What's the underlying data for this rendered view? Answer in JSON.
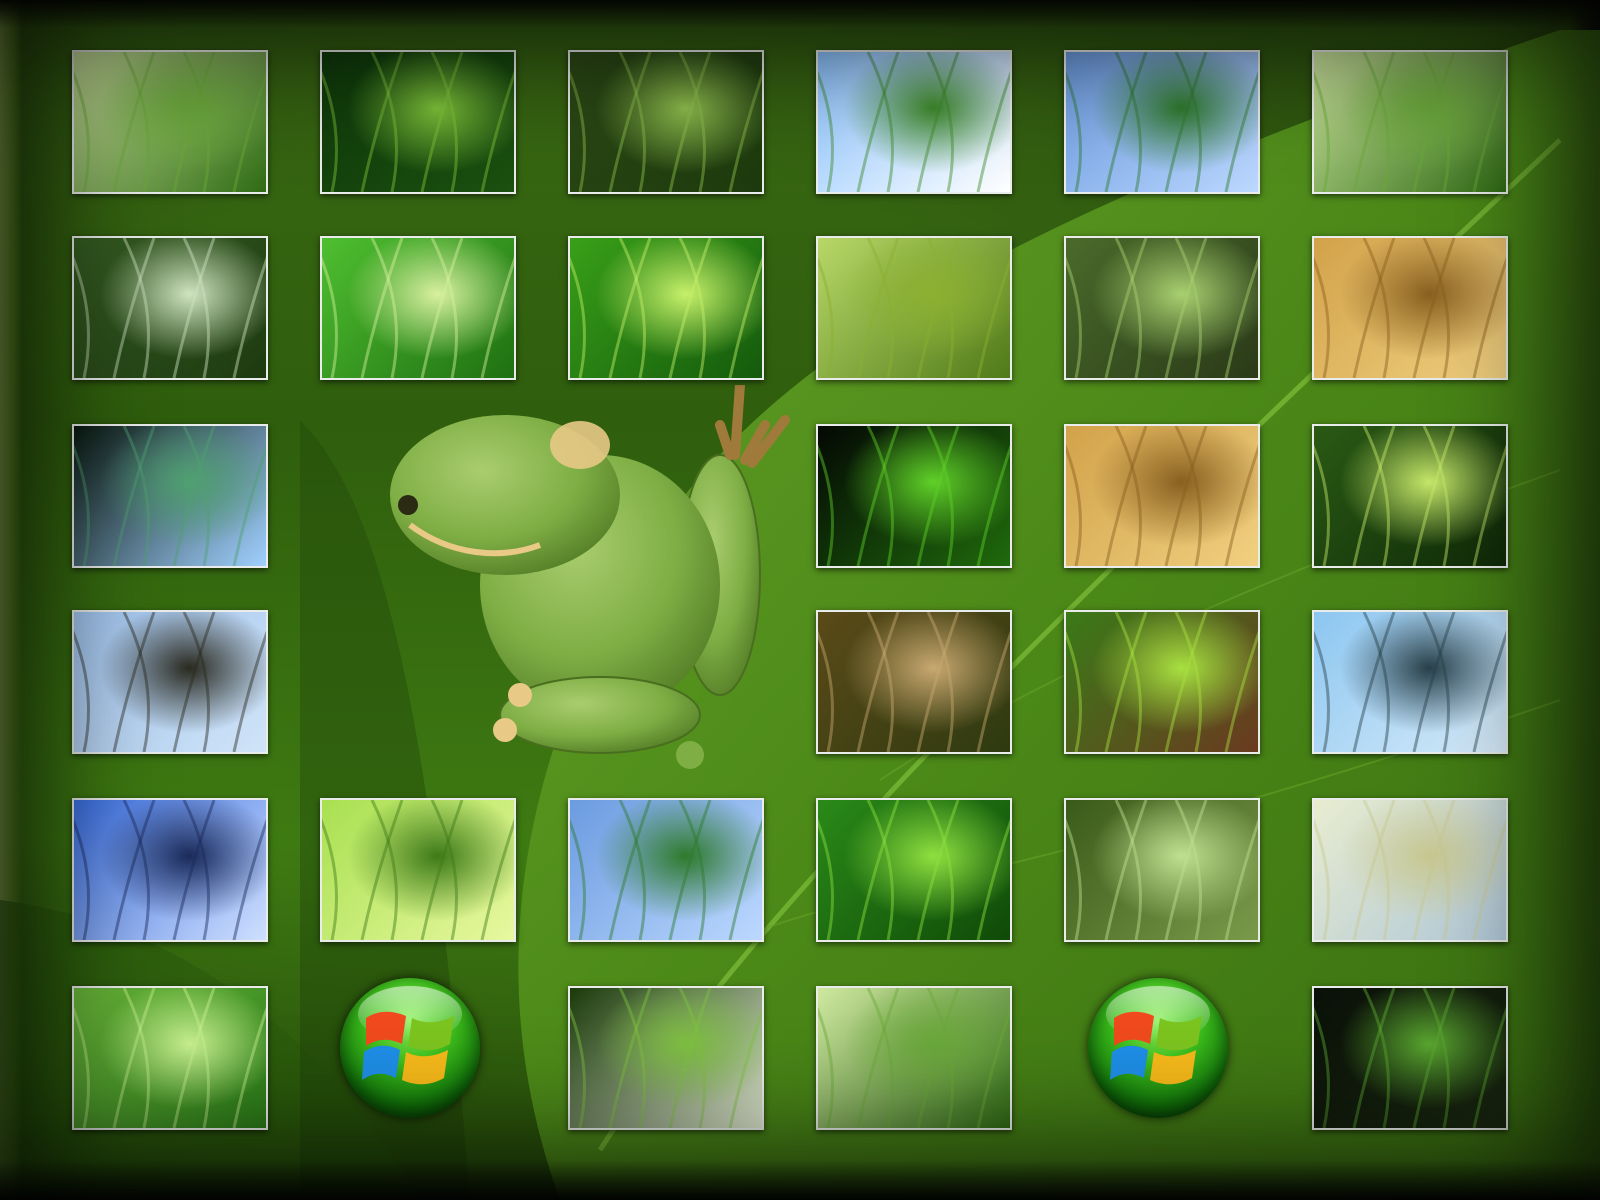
{
  "wallpaper": {
    "theme": "nature-collage",
    "colors": {
      "background": "#3b6a14",
      "thumb_border": "#e9ecea",
      "orb_green": "#3fbf1d"
    }
  },
  "photos": [
    {
      "id": "grass-blades",
      "subject": "grass"
    },
    {
      "id": "sprouting-leaves",
      "subject": "sprout"
    },
    {
      "id": "dewdrop-grass",
      "subject": "dew-on-grass"
    },
    {
      "id": "leaf-blue-sky",
      "subject": "leaf-and-sky"
    },
    {
      "id": "grass-against-sky",
      "subject": "grass-and-sky"
    },
    {
      "id": "yellow-grass",
      "subject": "grass"
    },
    {
      "id": "feathery-grass",
      "subject": "grass-plume"
    },
    {
      "id": "leaf-veins",
      "subject": "leaf-veins"
    },
    {
      "id": "leaf-droplets",
      "subject": "leaf-with-droplets"
    },
    {
      "id": "green-blades",
      "subject": "blades"
    },
    {
      "id": "tendril-plant",
      "subject": "tendril"
    },
    {
      "id": "golden-wheat",
      "subject": "wheat"
    },
    {
      "id": "dew-stem",
      "subject": "dew-on-stem"
    },
    {
      "id": "furled-leaves",
      "subject": "furled-leaves"
    },
    {
      "id": "orange-wheat",
      "subject": "wheat"
    },
    {
      "id": "leaves-bokeh",
      "subject": "leaves"
    },
    {
      "id": "grass-seedheads",
      "subject": "seedheads"
    },
    {
      "id": "single-seedhead",
      "subject": "seedhead"
    },
    {
      "id": "birch-leaf",
      "subject": "leaf"
    },
    {
      "id": "grass-flowers-sky",
      "subject": "grass-flowers"
    },
    {
      "id": "water-drop-twig",
      "subject": "water-drop"
    },
    {
      "id": "palm-frond",
      "subject": "palm"
    },
    {
      "id": "grass-blue-sky",
      "subject": "grass-and-sky"
    },
    {
      "id": "fern-frond",
      "subject": "fern"
    },
    {
      "id": "dewdrop-blades",
      "subject": "dew"
    },
    {
      "id": "meadow-field",
      "subject": "meadow"
    },
    {
      "id": "leaf-drop",
      "subject": "leaf-with-drop"
    },
    {
      "id": "droplets-leaf",
      "subject": "droplets"
    },
    {
      "id": "wild-grass",
      "subject": "grass"
    },
    {
      "id": "leaf-tip-drop",
      "subject": "leaf-tip"
    }
  ],
  "orbs": [
    {
      "icon": "windows-logo-icon"
    },
    {
      "icon": "windows-logo-icon"
    }
  ],
  "frog": {
    "icon": "tree-frog"
  }
}
